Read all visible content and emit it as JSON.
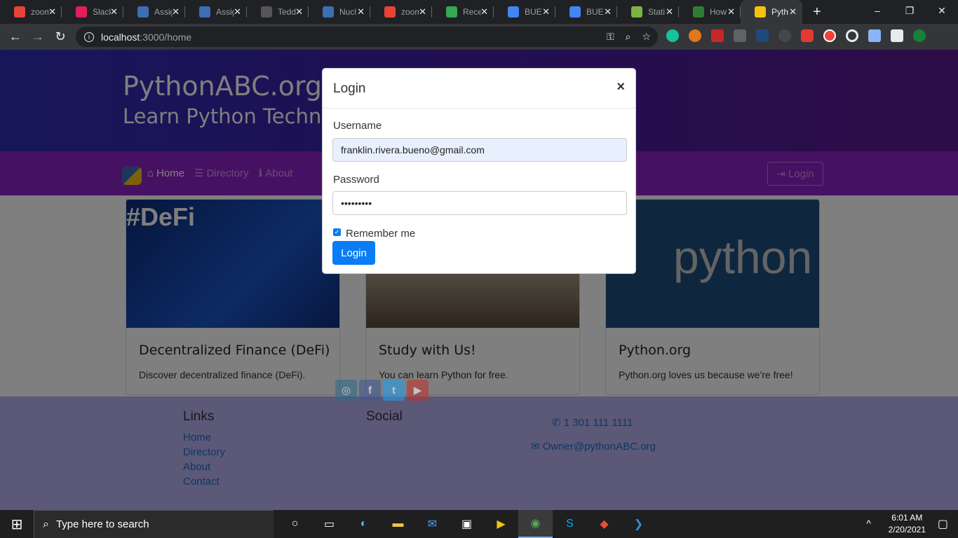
{
  "browser": {
    "tabs": [
      {
        "label": "zoom",
        "favicon": "gmail-icon",
        "color": "#ea4335"
      },
      {
        "label": "Slack",
        "favicon": "slack-icon",
        "color": "#e01e5a"
      },
      {
        "label": "Assig",
        "favicon": "assign-icon",
        "color": "#3c6eb4"
      },
      {
        "label": "Assig",
        "favicon": "assign-icon",
        "color": "#3c6eb4"
      },
      {
        "label": "Tedd",
        "favicon": "github-icon",
        "color": "#555555"
      },
      {
        "label": "Nucl",
        "favicon": "nucl-icon",
        "color": "#3c6eb4"
      },
      {
        "label": "zoom",
        "favicon": "gmail-icon",
        "color": "#ea4335"
      },
      {
        "label": "Rece",
        "favicon": "drive-icon",
        "color": "#34a853"
      },
      {
        "label": "BUE",
        "favicon": "docs-icon",
        "color": "#4285f4"
      },
      {
        "label": "BUE",
        "favicon": "docs-icon",
        "color": "#4285f4"
      },
      {
        "label": "Stati",
        "favicon": "stat-icon",
        "color": "#7cb342"
      },
      {
        "label": "How",
        "favicon": "how-icon",
        "color": "#2e7d32"
      },
      {
        "label": "Pyth",
        "favicon": "python-icon",
        "color": "#f5c20d",
        "active": true
      }
    ],
    "url_host": "localhost",
    "url_path": ":3000/home"
  },
  "site": {
    "title": "PythonABC.org",
    "subtitle": "Learn Python Technol",
    "nav": {
      "home": "Home",
      "directory": "Directory",
      "about": "About",
      "login": "Login"
    },
    "cards": [
      {
        "title": "Decentralized Finance (DeFi)",
        "text": "Discover decentralized finance (DeFi).",
        "image_text": "#DeFi"
      },
      {
        "title": "Study with Us!",
        "text": "You can learn Python for free."
      },
      {
        "title": "Python.org",
        "text": "Python.org loves us because we're free!",
        "image_text": "python"
      }
    ],
    "footer": {
      "links_heading": "Links",
      "links": [
        "Home",
        "Directory",
        "About",
        "Contact"
      ],
      "social_heading": "Social",
      "phone": "1 301 111 1111",
      "email": "Owner@pythonABC.org"
    }
  },
  "modal": {
    "title": "Login",
    "close": "×",
    "username_label": "Username",
    "username_value": "franklin.rivera.bueno@gmail.com",
    "password_label": "Password",
    "password_value": "•••••••••",
    "remember_label": "Remember me",
    "remember_checked": true,
    "submit_label": "Login"
  },
  "taskbar": {
    "search_placeholder": "Type here to search",
    "time": "6:01 AM",
    "date": "2/20/2021"
  }
}
